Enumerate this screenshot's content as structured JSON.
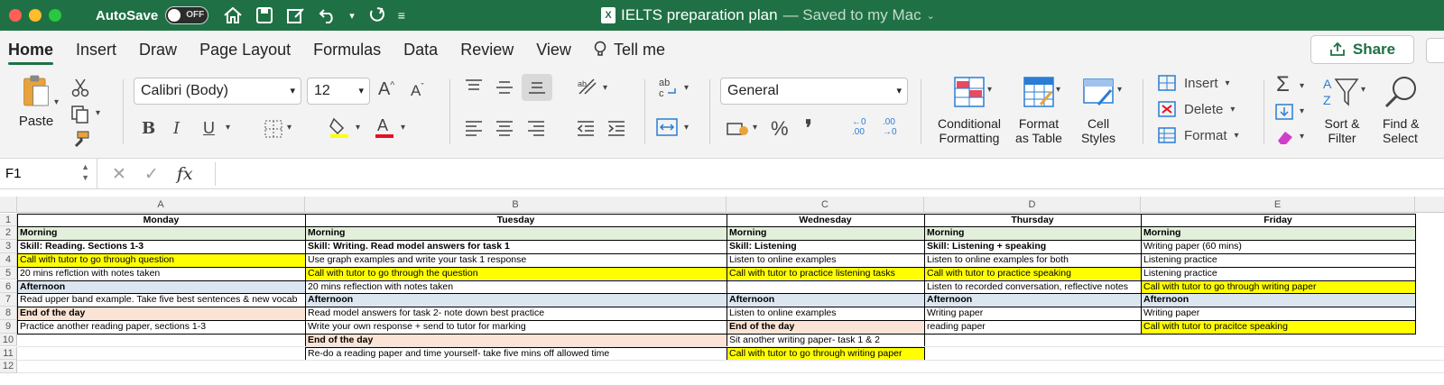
{
  "window": {
    "autosave_label": "AutoSave",
    "autosave_state": "OFF",
    "title": "IELTS preparation plan",
    "saved_status": "— Saved to my Mac",
    "file_icon_letter": "X"
  },
  "tabs": [
    "Home",
    "Insert",
    "Draw",
    "Page Layout",
    "Formulas",
    "Data",
    "Review",
    "View",
    "Tell me"
  ],
  "share_label": "Share",
  "ribbon": {
    "paste_label": "Paste",
    "font_name": "Calibri (Body)",
    "font_size": "12",
    "bold": "B",
    "italic": "I",
    "underline": "U",
    "number_format": "General",
    "percent": "%",
    "comma": "❜",
    "decimal_more": ".00",
    "decimal_less": ".00",
    "conditional_formatting": [
      "Conditional",
      "Formatting"
    ],
    "format_as_table": [
      "Format",
      "as Table"
    ],
    "cell_styles": [
      "Cell",
      "Styles"
    ],
    "insert": "Insert",
    "delete": "Delete",
    "format": "Format",
    "sort_filter": [
      "Sort &",
      "Filter"
    ],
    "find_select": [
      "Find &",
      "Select"
    ]
  },
  "formula_bar": {
    "name_box": "F1",
    "fx_label": "fx",
    "content": ""
  },
  "colors": {
    "title_green": "#1f7145",
    "highlight_yellow": "#ffff00",
    "section_blue": "#dce6f0",
    "section_green": "#e2efda",
    "section_peach": "#fbe4d5"
  },
  "columns": [
    "A",
    "B",
    "C",
    "D",
    "E"
  ],
  "rows": [
    "1",
    "2",
    "3",
    "4",
    "5",
    "6",
    "7",
    "8",
    "9",
    "10",
    "11",
    "12"
  ],
  "sheet": {
    "A": [
      "Monday",
      "Morning",
      "Skill: Reading. Sections 1-3",
      "Call with tutor to go through question",
      "20 mins reflction with notes taken",
      "Afternoon",
      "Read upper band example. Take five best sentences & new vocab",
      "End of the day",
      "Practice another reading paper, sections 1-3",
      "",
      ""
    ],
    "B": [
      "Tuesday",
      "Morning",
      "Skill: Writing. Read model answers for task 1",
      "Use graph examples and write your task 1 response",
      "Call with tutor to go through the question",
      "20 mins reflection with notes taken",
      "Afternoon",
      "Read model answers for task 2- note down best practice",
      "Write your own response + send to tutor for marking",
      "End of the day",
      "Re-do a reading paper and time yourself- take five mins off allowed time"
    ],
    "C": [
      "Wednesday",
      "Morning",
      "Skill: Listening",
      "Listen to online examples",
      "Call with tutor to practice listening tasks",
      "",
      "Afternoon",
      "Listen to online examples",
      "End of the day",
      "Sit another writing paper- task 1 & 2",
      "Call with tutor to go through writing paper"
    ],
    "D": [
      "Thursday",
      "Morning",
      "Skill: Listening + speaking",
      "Listen to online examples for both",
      "Call with tutor to practice speaking",
      "Listen to recorded conversation, reflective notes",
      "Afternoon",
      "Writing paper",
      "reading paper",
      "",
      ""
    ],
    "E": [
      "Friday",
      "Morning",
      "Writing paper (60 mins)",
      "Listening practice",
      "Listening practice",
      "Call with tutor to go through writing paper",
      "Afternoon",
      "Writing paper",
      "Call with tutor to pracitce speaking",
      "",
      ""
    ]
  }
}
